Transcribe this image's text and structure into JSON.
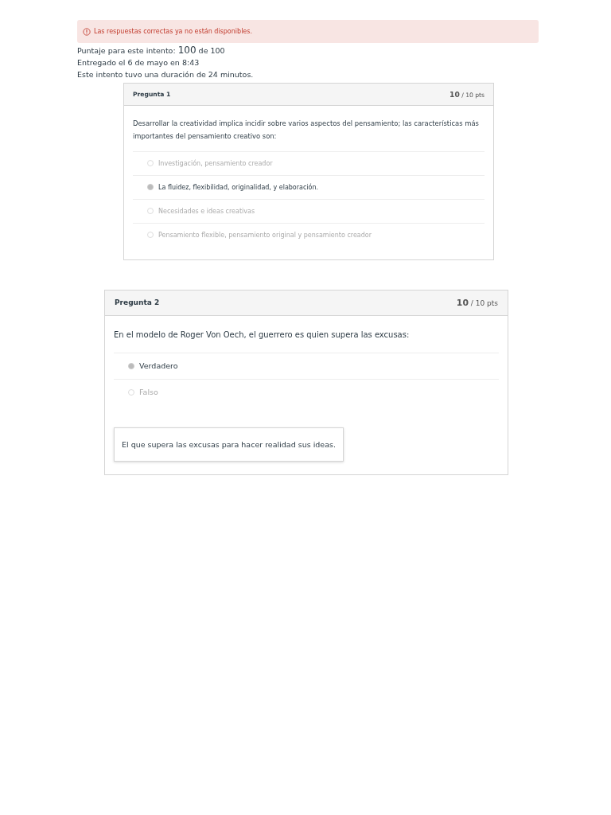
{
  "alert": {
    "text": "Las respuestas correctas ya no están disponibles."
  },
  "summary": {
    "score_label": "Puntaje para este intento:",
    "score": "100",
    "score_total": "de 100",
    "submitted": "Entregado el 6 de mayo en 8:43",
    "duration": "Este intento tuvo una duración de 24 minutos."
  },
  "questions": [
    {
      "title": "Pregunta 1",
      "points": "10",
      "points_total": "/ 10 pts",
      "text": "Desarrollar la creatividad implica incidir sobre varios aspectos del pensamiento; las características más importantes del pensamiento creativo son:",
      "answers": [
        {
          "text": "Investigación, pensamiento creador",
          "selected": false
        },
        {
          "text": "La fluidez, flexibilidad, originalidad, y elaboración.",
          "selected": true
        },
        {
          "text": "Necesidades e ideas creativas",
          "selected": false
        },
        {
          "text": "Pensamiento flexible, pensamiento original y pensamiento creador",
          "selected": false
        }
      ]
    },
    {
      "title": "Pregunta 2",
      "points": "10",
      "points_total": "/ 10 pts",
      "text": "En el modelo de Roger Von Oech, el guerrero es quien supera las excusas:",
      "answers": [
        {
          "text": "Verdadero",
          "selected": true
        },
        {
          "text": "Falso",
          "selected": false
        }
      ],
      "comment": "El que supera las excusas para hacer realidad sus ideas."
    }
  ]
}
